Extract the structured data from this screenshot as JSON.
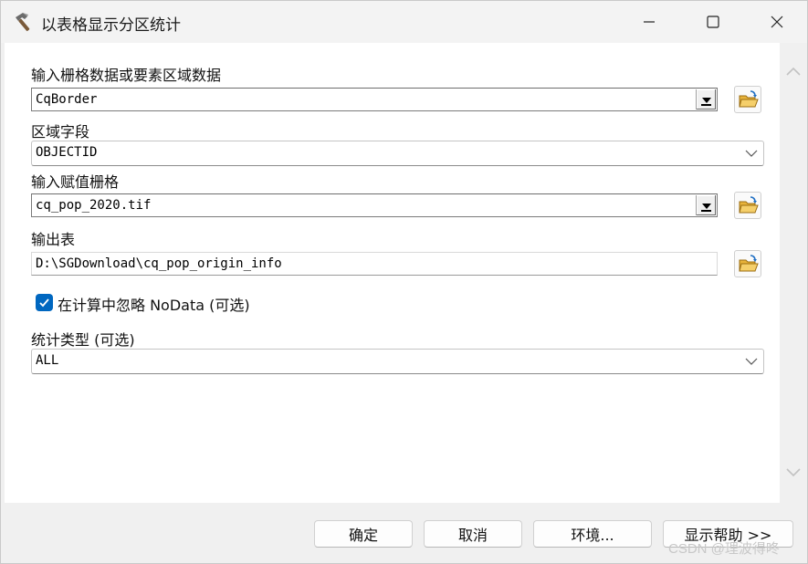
{
  "window": {
    "title": "以表格显示分区统计",
    "icon": "hammer-icon"
  },
  "form": {
    "input_zone": {
      "label": "输入栅格数据或要素区域数据",
      "value": "CqBorder"
    },
    "zone_field": {
      "label": "区域字段",
      "value": "OBJECTID"
    },
    "value_raster": {
      "label": "输入赋值栅格",
      "value": "cq_pop_2020.tif"
    },
    "output_table": {
      "label": "输出表",
      "value": "D:\\SGDownload\\cq_pop_origin_info"
    },
    "ignore_nodata": {
      "label": "在计算中忽略 NoData (可选)",
      "checked": true
    },
    "statistics_type": {
      "label": "统计类型 (可选)",
      "value": "ALL"
    }
  },
  "buttons": {
    "ok": "确定",
    "cancel": "取消",
    "environments": "环境...",
    "show_help": "显示帮助 >>"
  },
  "watermark": "CSDN @理波得咚",
  "colors": {
    "accent": "#0067c0",
    "folder": "#e8b33a"
  }
}
